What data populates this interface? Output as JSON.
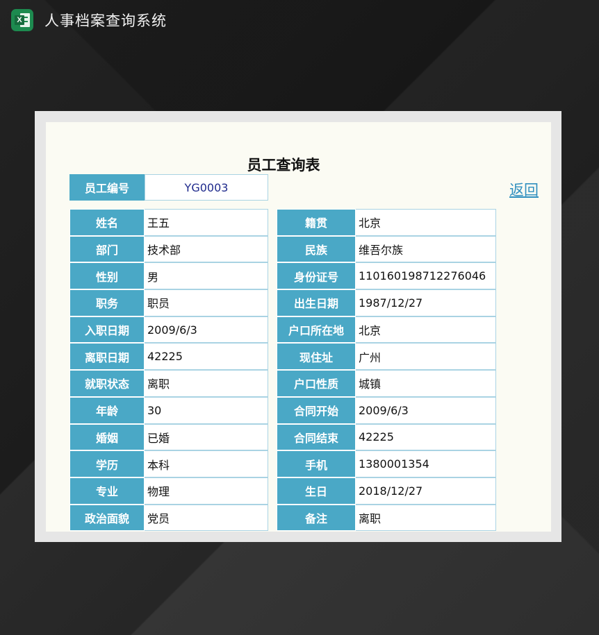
{
  "app": {
    "title": "人事档案查询系统",
    "icon": "excel-icon",
    "icon_letter": "X"
  },
  "form": {
    "title": "员工查询表",
    "employee_id_label": "员工编号",
    "employee_id_value": "YG0003",
    "back_label": "返回"
  },
  "left_fields": [
    {
      "label": "姓名",
      "value": "王五"
    },
    {
      "label": "部门",
      "value": "技术部"
    },
    {
      "label": "性别",
      "value": "男"
    },
    {
      "label": "职务",
      "value": "职员"
    },
    {
      "label": "入职日期",
      "value": "2009/6/3"
    },
    {
      "label": "离职日期",
      "value": "42225"
    },
    {
      "label": "就职状态",
      "value": "离职"
    },
    {
      "label": "年龄",
      "value": "30"
    },
    {
      "label": "婚姻",
      "value": "已婚"
    },
    {
      "label": "学历",
      "value": "本科"
    },
    {
      "label": "专业",
      "value": "物理"
    },
    {
      "label": "政治面貌",
      "value": "党员"
    }
  ],
  "right_fields": [
    {
      "label": "籍贯",
      "value": "北京"
    },
    {
      "label": "民族",
      "value": "维吾尔族"
    },
    {
      "label": "身份证号",
      "value": "110160198712276046"
    },
    {
      "label": "出生日期",
      "value": "1987/12/27"
    },
    {
      "label": "户口所在地",
      "value": "北京"
    },
    {
      "label": "现住址",
      "value": "广州"
    },
    {
      "label": "户口性质",
      "value": "城镇"
    },
    {
      "label": "合同开始",
      "value": "2009/6/3"
    },
    {
      "label": "合同结束",
      "value": "42225"
    },
    {
      "label": "手机",
      "value": "1380001354"
    },
    {
      "label": "生日",
      "value": "2018/12/27"
    },
    {
      "label": "备注",
      "value": "离职"
    }
  ],
  "colors": {
    "label_bg": "#4aa8c6",
    "link": "#2f8fbf",
    "panel_bg": "#fbfbf3",
    "id_value": "#1f2a8c"
  }
}
